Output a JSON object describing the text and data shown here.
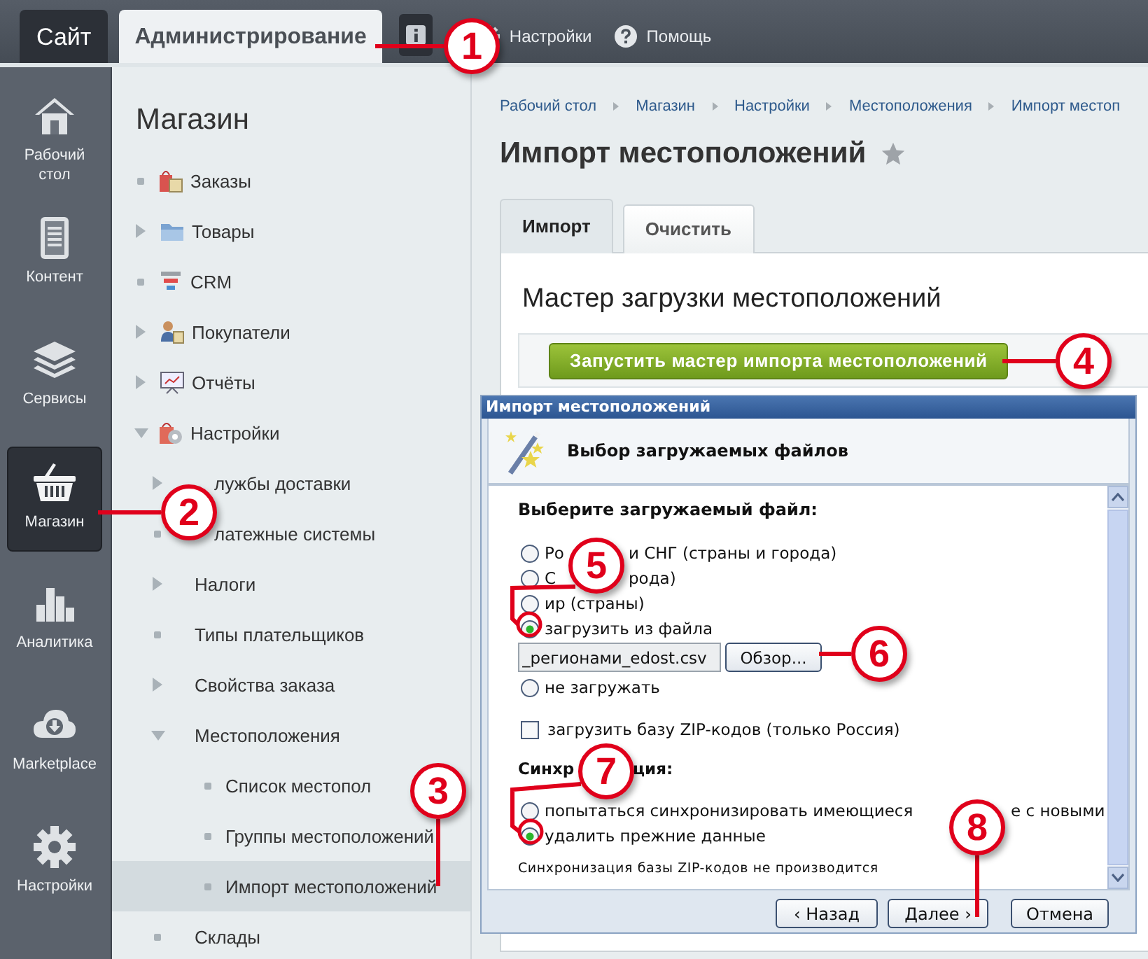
{
  "top_bar": {
    "tabs": [
      {
        "label": "Сайт",
        "selected": false
      },
      {
        "label": "Администрирование",
        "selected": true
      }
    ],
    "links": [
      {
        "kind": "settings",
        "label": "Настройки"
      },
      {
        "kind": "help",
        "label": "Помощь"
      }
    ]
  },
  "rail": [
    {
      "label": "Рабочий стол",
      "selected": false
    },
    {
      "label": "Контент",
      "selected": false
    },
    {
      "label": "Сервисы",
      "selected": false
    },
    {
      "label": "Магазин",
      "selected": true
    },
    {
      "label": "Аналитика",
      "selected": false
    },
    {
      "label": "Marketplace",
      "selected": false
    },
    {
      "label": "Настройки",
      "selected": false
    }
  ],
  "menu": {
    "title": "Магазин",
    "items": [
      {
        "label": "Заказы",
        "kind": "leaf",
        "selected": false
      },
      {
        "label": "Товары",
        "kind": "branch",
        "expanded": false,
        "selected": false
      },
      {
        "label": "CRM",
        "kind": "leaf",
        "selected": false
      },
      {
        "label": "Покупатели",
        "kind": "branch",
        "expanded": false,
        "selected": false
      },
      {
        "label": "Отчёты",
        "kind": "branch",
        "expanded": false,
        "selected": false
      },
      {
        "label": "Настройки",
        "kind": "branch",
        "expanded": true,
        "selected": false,
        "children": [
          {
            "label": "лужбы доставки",
            "kind": "branch",
            "expanded": false,
            "selected": false
          },
          {
            "label": "латежные системы",
            "kind": "leaf",
            "selected": false
          },
          {
            "label": "Налоги",
            "kind": "branch",
            "expanded": false,
            "selected": false
          },
          {
            "label": "Типы плательщиков",
            "kind": "leaf",
            "selected": false
          },
          {
            "label": "Свойства заказа",
            "kind": "branch",
            "expanded": false,
            "selected": false
          },
          {
            "label": "Местоположения",
            "kind": "branch",
            "expanded": true,
            "selected": false,
            "children": [
              {
                "label": "Список местопол",
                "kind": "leaf",
                "selected": false
              },
              {
                "label": "Группы местоположений",
                "kind": "leaf",
                "selected": false
              },
              {
                "label": "Импорт местоположений",
                "kind": "leaf",
                "selected": true
              }
            ]
          },
          {
            "label": "Склады",
            "kind": "leaf",
            "selected": false
          }
        ]
      }
    ]
  },
  "breadcrumb": [
    "Рабочий стол",
    "Магазин",
    "Настройки",
    "Местоположения",
    "Импорт местоп"
  ],
  "page": {
    "title": "Импорт местоположений",
    "tabs": [
      {
        "label": "Импорт",
        "selected": true
      },
      {
        "label": "Очистить",
        "selected": false
      }
    ],
    "section_title": "Мастер загрузки местоположений",
    "action_button": "Запустить мастер импорта местоположений"
  },
  "dialog": {
    "title": "Импорт местоположений",
    "step_title": "Выбор загружаемых файлов",
    "file_heading": "Выберите загружаемый файл:",
    "file_options": [
      {
        "label_parts": [
          "Ро",
          "и СНГ (страны и города)"
        ],
        "selected": false
      },
      {
        "label_parts": [
          "С",
          "рода)"
        ],
        "selected": false
      },
      {
        "label_parts": [
          "ир (страны)"
        ],
        "selected": false
      },
      {
        "label_parts": [
          "загрузить из файла"
        ],
        "selected": true,
        "file": {
          "value": "_регионами_edost.csv",
          "button": "Обзор..."
        }
      },
      {
        "label_parts": [
          "не загружать"
        ],
        "selected": false
      }
    ],
    "zip_option": {
      "label": "загрузить базу ZIP-кодов (только Россия)",
      "checked": false
    },
    "sync_heading_parts": [
      "Синхр",
      "ция:"
    ],
    "sync_options": [
      {
        "label_parts": [
          "попытаться синхронизировать имеющиеся",
          "е с новыми"
        ],
        "selected": false
      },
      {
        "label_parts": [
          "удалить прежние данные"
        ],
        "selected": true
      }
    ],
    "note": "Синхронизация базы ZIP-кодов не производится",
    "buttons": [
      {
        "kind": "back",
        "label": "‹ Назад"
      },
      {
        "kind": "next",
        "label": "Далее ›"
      },
      {
        "kind": "cancel",
        "label": "Отмена"
      }
    ]
  },
  "callouts": [
    "1",
    "2",
    "3",
    "4",
    "5",
    "6",
    "7",
    "8"
  ]
}
